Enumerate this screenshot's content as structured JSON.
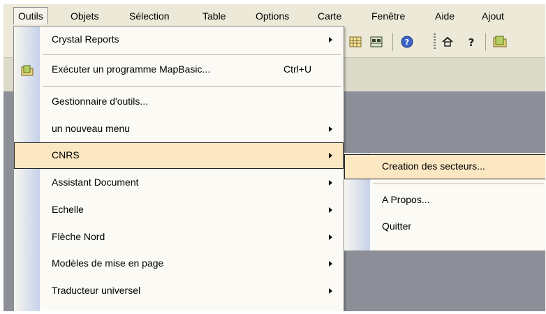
{
  "menubar": {
    "items": [
      "Outils",
      "Objets",
      "Sélection",
      "Table",
      "Options",
      "Carte",
      "Fenêtre",
      "Aide",
      "Ajout"
    ]
  },
  "toolbar_icons": [
    "grid-icon",
    "table-icon",
    "help-icon",
    "home-icon",
    "question-icon",
    "folder-icon"
  ],
  "outils_menu": {
    "items": [
      {
        "label": "Crystal Reports",
        "submenu": true
      },
      {
        "label": "Exécuter un programme MapBasic...",
        "shortcut": "Ctrl+U",
        "icon": "folder-icon"
      },
      {
        "label": "Gestionnaire d'outils..."
      },
      {
        "label": "un nouveau menu",
        "submenu": true
      },
      {
        "label": "CNRS",
        "submenu": true,
        "highlighted": true
      },
      {
        "label": "Assistant Document",
        "submenu": true
      },
      {
        "label": "Echelle",
        "submenu": true
      },
      {
        "label": "Flèche Nord",
        "submenu": true
      },
      {
        "label": "Modèles de mise en page",
        "submenu": true
      },
      {
        "label": "Traducteur universel",
        "submenu": true
      }
    ]
  },
  "cnrs_submenu": {
    "items": [
      {
        "label": "Creation des secteurs...",
        "highlighted": true
      },
      {
        "label": "A Propos..."
      },
      {
        "label": "Quitter"
      }
    ]
  },
  "colors": {
    "menu_background": "#fbfaf5",
    "highlight": "#fbe7c2",
    "gutter": "#c7d2e9",
    "workspace": "#8d8f98"
  }
}
